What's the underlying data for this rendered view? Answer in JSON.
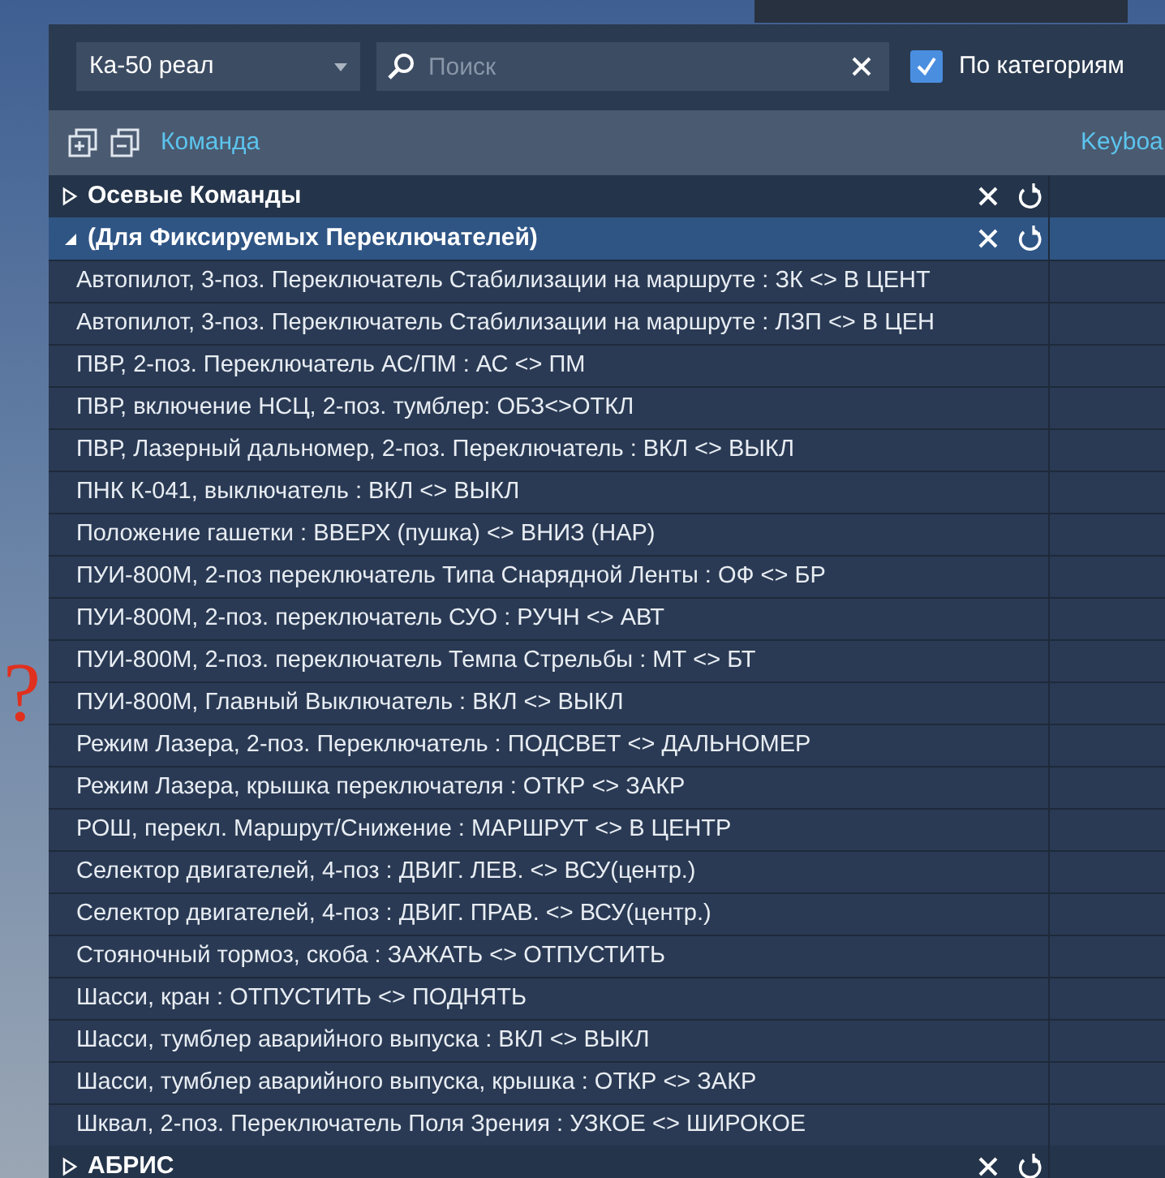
{
  "toolbar": {
    "profile": "Ка-50 реал",
    "search": {
      "placeholder": "Поиск"
    },
    "by_category": {
      "label": "По категориям",
      "checked": true
    }
  },
  "columns": [
    "Команда",
    "Keyboa"
  ],
  "categories": [
    {
      "label": "Осевые Команды",
      "expanded": false,
      "selected": false
    },
    {
      "label": "(Для Фиксируемых Переключателей)",
      "expanded": true,
      "selected": true,
      "rows": [
        "Автопилот, 3-поз. Переключатель Стабилизации на маршруте : ЗК <> В ЦЕНТ",
        "Автопилот, 3-поз. Переключатель Стабилизации на маршруте : ЛЗП <> В ЦЕН",
        "ПВР, 2-поз. Переключатель АС/ПМ : АС <> ПМ",
        "ПВР, включение НСЦ, 2-поз. тумблер: ОБЗ<>ОТКЛ",
        "ПВР, Лазерный дальномер, 2-поз. Переключатель : ВКЛ <> ВЫКЛ",
        "ПНК К-041, выключатель : ВКЛ <> ВЫКЛ",
        "Положение гашетки : ВВЕРХ (пушка) <> ВНИЗ (НАР)",
        "ПУИ-800М, 2-поз переключатель Типа Снарядной Ленты : ОФ <> БР",
        "ПУИ-800М, 2-поз. переключатель СУО : РУЧН <> АВТ",
        "ПУИ-800М, 2-поз. переключатель Темпа Стрельбы : МТ <> БТ",
        "ПУИ-800М, Главный Выключатель : ВКЛ <> ВЫКЛ",
        "Режим Лазера, 2-поз. Переключатель : ПОДСВЕТ <> ДАЛЬНОМЕР",
        "Режим Лазера, крышка переключателя : ОТКР <> ЗАКР",
        "РОШ, перекл. Маршрут/Снижение : МАРШРУТ <> В ЦЕНТР",
        "Селектор двигателей, 4-поз : ДВИГ. ЛЕВ. <> ВСУ(центр.)",
        "Селектор двигателей, 4-поз : ДВИГ. ПРАВ. <> ВСУ(центр.)",
        "Стояночный тормоз, скоба : ЗАЖАТЬ <> ОТПУСТИТЬ",
        "Шасси, кран : ОТПУСТИТЬ <> ПОДНЯТЬ",
        "Шасси, тумблер аварийного выпуска : ВКЛ <> ВЫКЛ",
        "Шасси, тумблер аварийного выпуска, крышка : ОТКР <> ЗАКР",
        "Шквал, 2-поз. Переключатель Поля Зрения : УЗКОЕ <> ШИРОКОЕ"
      ]
    },
    {
      "label": "АБРИС",
      "expanded": false,
      "selected": false
    }
  ],
  "annotation": "?"
}
